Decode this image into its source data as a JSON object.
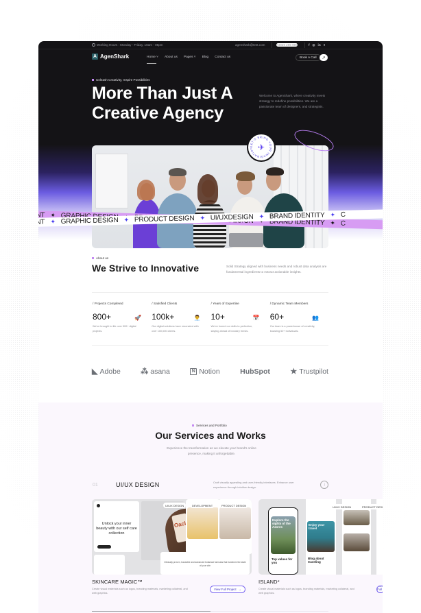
{
  "topbar": {
    "hours_label": "Working Hours : Monday - Friday, 10am - 05pm",
    "email": "agenshark@test.com",
    "phone": "+3929 299 999",
    "social": [
      "f",
      "◎",
      "in",
      "●"
    ]
  },
  "nav": {
    "logo_mark": "A",
    "logo_text": "AgenShark",
    "items": [
      {
        "label": "Home ˅"
      },
      {
        "label": "About us"
      },
      {
        "label": "Pages ˅"
      },
      {
        "label": "Blog"
      },
      {
        "label": "Contact us"
      }
    ],
    "book_label": "Book A Call",
    "book_arrow": "↗"
  },
  "hero": {
    "eyebrow": "Unleash Creativity, Inspire Possibilities",
    "title_line1": "More Than Just A",
    "title_line2": "Creative Agency",
    "description": "Welcome to AgenShark, where creativity meets strategy to redefine possibilities. We are a passionate team of designers, and strategists.",
    "badge_text": "LET'S BRING YOUR IMAGINATION • ",
    "badge_icon": "✈"
  },
  "ribbon": {
    "items": [
      "ENT",
      "GRAPHIC DESIGN",
      "PRODUCT DESIGN",
      "UI/UXDESIGN",
      "BRAND IDENTITY",
      "C"
    ],
    "separator": "✦"
  },
  "about": {
    "eyebrow": "About us",
    "title": "We Strive to Innovative",
    "description": "Solid Strategy aligned with business needs and robust data analysis are fundamental ingredients to extract actionable insights.",
    "stats": [
      {
        "label": "/ Projects Completed",
        "value": "800+",
        "icon": "🚀",
        "desc": "We've brought to life over 500+ digital projects."
      },
      {
        "label": "/ Satisfied Clients",
        "value": "100k+",
        "icon": "👨‍💼",
        "desc": "Our digital solutions have resonated with over 100,000 clients."
      },
      {
        "label": "/ Years of Expertise",
        "value": "10+",
        "icon": "📅",
        "desc": "We've honed our skills to perfection, staying ahead of industry trends."
      },
      {
        "label": "/ Dynamic Team Members",
        "value": "60+",
        "icon": "👥",
        "desc": "Our team is a powerhouse of creativity, boasting 60+ individuals."
      }
    ]
  },
  "logos": [
    {
      "name": "Adobe",
      "icon": "◣"
    },
    {
      "name": "asana",
      "icon": "⁂"
    },
    {
      "name": "Notion",
      "icon": "N"
    },
    {
      "name": "HubSpot",
      "icon": ""
    },
    {
      "name": "Trustpilot",
      "icon": "★"
    }
  ],
  "services": {
    "eyebrow": "Services and Portfolio",
    "title": "Our Services and Works",
    "description": "Experience the transformation as we elevate your brand's online presence, making it unforgettable.",
    "row": {
      "number": "01",
      "name": "UI/UX DESIGN",
      "description": "Craft visually appealing and user-friendly interfaces. Enhance user experience through intuitive design.",
      "toggle_icon": "↓"
    },
    "cards": [
      {
        "title": "SKINCARE MAGIC™",
        "description": "Create visual materials such as logos, branding materials, marketing collateral, and web graphics.",
        "button": "View Full Project",
        "button_icon": "→",
        "tags": [
          "UI/UX DESIGN",
          "DEVELOPMENT",
          "PRODUCT DESIGN"
        ],
        "mock_headline": "Unlock your inner beauty with our self care collection",
        "mock_bottle": "Oacle",
        "mock_caption": "Clinically proven, traceable and advanced botanical formulas that transform the state of your skin"
      },
      {
        "title": "ISLAND*",
        "description": "Create visual materials such as logos, branding materials, marketing collateral, and web graphics.",
        "button": "View Full Project",
        "button_icon": "→",
        "tags": [
          "UI/UX DESIGN",
          "PRODUCT DESIGN"
        ],
        "mock_phone1": "Explore the sights of the Azores",
        "mock_phone1_sub": "Top values for you",
        "mock_phone2": "Enjoy your travel",
        "mock_phone2_sub": "Blog about traveling"
      }
    ],
    "carousel_progress": 0.5
  }
}
